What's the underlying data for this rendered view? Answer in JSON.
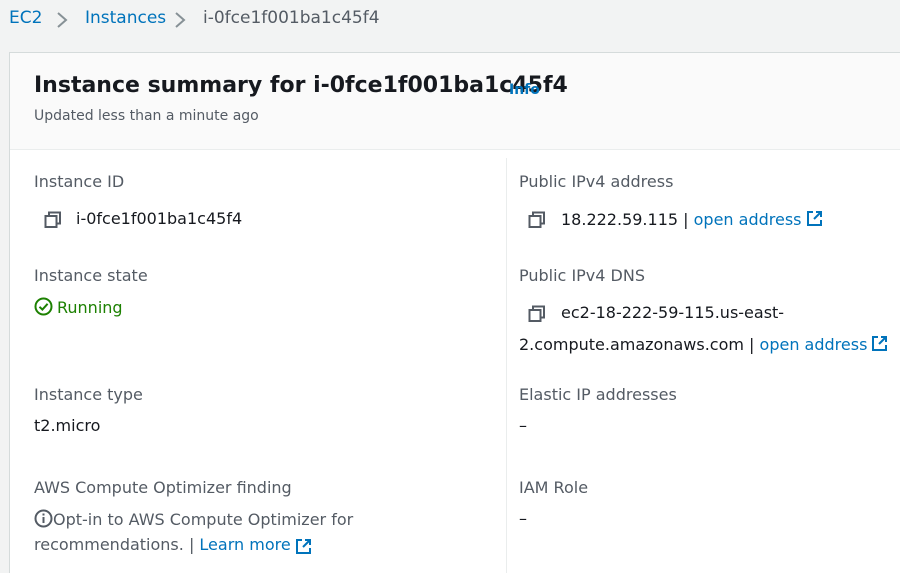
{
  "breadcrumb": {
    "ec2": "EC2",
    "instances": "Instances",
    "current": "i-0fce1f001ba1c45f4"
  },
  "header": {
    "title": "Instance summary for i-0fce1f001ba1c45f4",
    "info": "Info",
    "subtitle": "Updated less than a minute ago"
  },
  "fields": {
    "instance_id": {
      "label": "Instance ID",
      "value": "i-0fce1f001ba1c45f4"
    },
    "public_ipv4": {
      "label": "Public IPv4 address",
      "value": "18.222.59.115",
      "separator": "|",
      "link": "open address"
    },
    "instance_state": {
      "label": "Instance state",
      "value": "Running"
    },
    "public_dns": {
      "label": "Public IPv4 DNS",
      "value_line1": "ec2-18-222-59-115.us-east-",
      "value_line2": "2.compute.amazonaws.com",
      "separator": "|",
      "link": "open address"
    },
    "instance_type": {
      "label": "Instance type",
      "value": "t2.micro"
    },
    "elastic_ip": {
      "label": "Elastic IP addresses",
      "value": "–"
    },
    "optimizer": {
      "label": "AWS Compute Optimizer finding",
      "text_line1": "Opt-in to AWS Compute Optimizer for",
      "text_line2": "recommendations.",
      "separator": "|",
      "link": "Learn more"
    },
    "iam_role": {
      "label": "IAM Role",
      "value": "–"
    }
  },
  "colors": {
    "link": "#0073bb",
    "running": "#1d8102",
    "label": "#545b64",
    "text": "#16191f"
  },
  "icons": [
    "chevron-right-icon",
    "copy-icon",
    "external-link-icon",
    "check-circle-icon",
    "info-circle-icon"
  ]
}
